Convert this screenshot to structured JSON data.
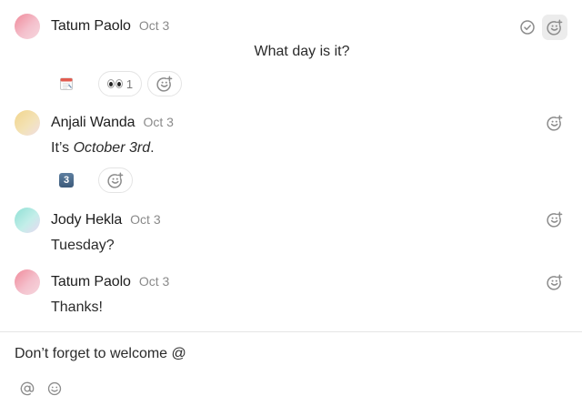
{
  "messages": [
    {
      "author": "Tatum Paolo",
      "date": "Oct 3",
      "text": "What day is it?",
      "reactions": [
        {
          "emoji_name": "calendar-emoji"
        },
        {
          "emoji_name": "eyes-emoji",
          "count": "1"
        }
      ]
    },
    {
      "author": "Anjali Wanda",
      "date": "Oct 3",
      "text_prefix": "It’s ",
      "text_emphasis": "October 3rd",
      "text_suffix": ".",
      "reactions": [
        {
          "emoji_name": "keycap-3-emoji",
          "glyph": "3"
        }
      ]
    },
    {
      "author": "Jody Hekla",
      "date": "Oct 3",
      "text": "Tuesday?"
    },
    {
      "author": "Tatum Paolo",
      "date": "Oct 3",
      "text": "Thanks!"
    }
  ],
  "composer": {
    "value": "Don’t forget to welcome @"
  },
  "colors": {
    "avatar_tatum": "#f08a9a",
    "avatar_anjali": "#f2d58c",
    "avatar_jody": "#8fe0d4",
    "text": "#2a2a2a",
    "muted": "#8a8a8a",
    "icon": "#8c8c8c"
  }
}
